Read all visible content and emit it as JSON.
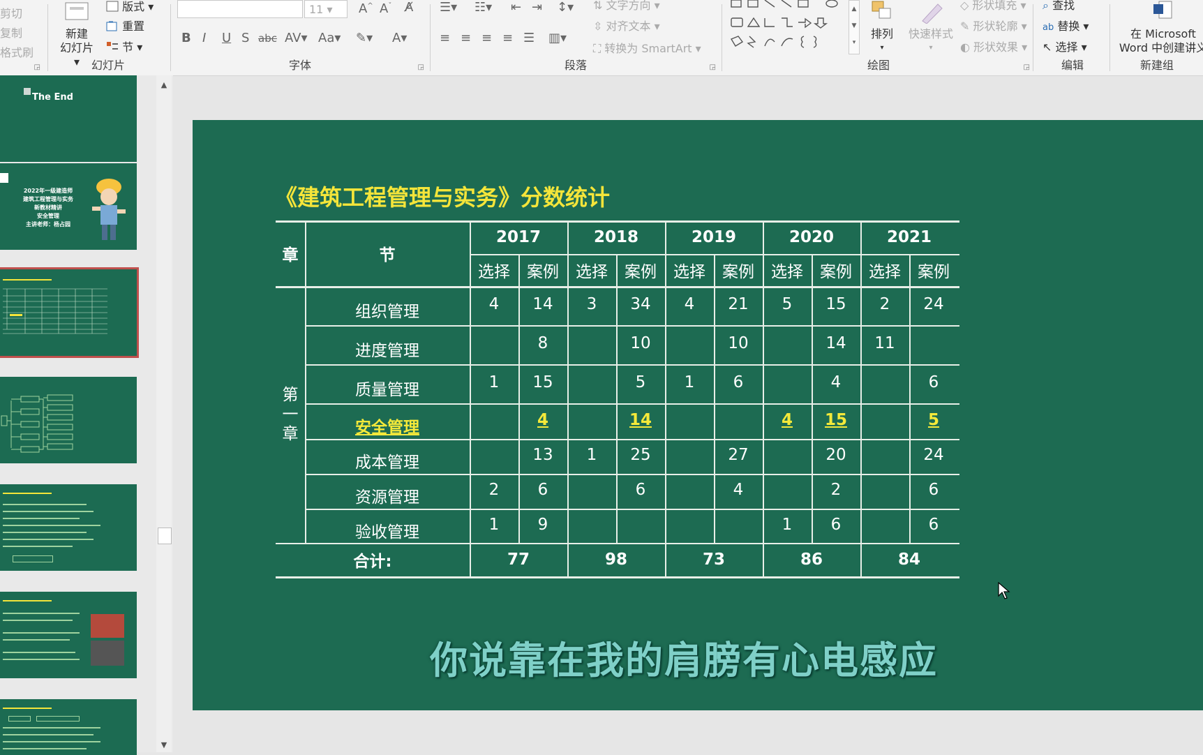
{
  "ribbon": {
    "clipboard": {
      "cut": "剪切",
      "copy": "复制",
      "format_painter": "格式刷"
    },
    "slides": {
      "new_slide_l1": "新建",
      "new_slide_l2": "幻灯片",
      "layout": "版式",
      "reset": "重置",
      "section": "节",
      "label": "幻灯片"
    },
    "font": {
      "size": "11",
      "label": "字体"
    },
    "paragraph": {
      "text_direction": "文字方向",
      "align_text": "对齐文本",
      "convert_smartart": "转换为 SmartArt",
      "label": "段落"
    },
    "drawing": {
      "arrange": "排列",
      "quick_styles": "快速样式",
      "shape_fill": "形状填充",
      "shape_outline": "形状轮廓",
      "shape_effects": "形状效果",
      "label": "绘图"
    },
    "editing": {
      "find": "查找",
      "replace": "替换",
      "select": "选择",
      "label": "编辑"
    },
    "new_group": {
      "line1": "在 Microsoft",
      "line2": "Word 中创建讲义",
      "label": "新建组"
    }
  },
  "thumbnails": [
    {
      "title": "The End"
    },
    {
      "line1": "2022年一级建造师",
      "line2": "建筑工程管理与实务",
      "line3": "新教材精讲",
      "line4": "安全管理",
      "line5": "主讲老师：杨占园"
    }
  ],
  "slide": {
    "title": "《建筑工程管理与实务》分数统计",
    "headers": {
      "chapter": "章",
      "section": "节",
      "years": [
        "2017",
        "2018",
        "2019",
        "2020",
        "2021"
      ],
      "choice": "选择",
      "case": "案例"
    },
    "chapter_chars": [
      "第",
      "一",
      "章"
    ],
    "rows": [
      {
        "name": "组织管理",
        "values": [
          "4",
          "14",
          "3",
          "34",
          "4",
          "21",
          "5",
          "15",
          "2",
          "24"
        ]
      },
      {
        "name": "进度管理",
        "values": [
          "",
          "8",
          "",
          "10",
          "",
          "10",
          "",
          "14",
          "11",
          ""
        ]
      },
      {
        "name": "质量管理",
        "values": [
          "1",
          "15",
          "",
          "5",
          "1",
          "6",
          "",
          "4",
          "",
          "6"
        ]
      },
      {
        "name": "安全管理",
        "values": [
          "",
          "4",
          "",
          "14",
          "",
          "",
          "4",
          "15",
          "",
          "5"
        ],
        "highlight": true
      },
      {
        "name": "成本管理",
        "values": [
          "",
          "13",
          "1",
          "25",
          "",
          "27",
          "",
          "20",
          "",
          "24"
        ]
      },
      {
        "name": "资源管理",
        "values": [
          "2",
          "6",
          "",
          "6",
          "",
          "4",
          "",
          "2",
          "",
          "6"
        ]
      },
      {
        "name": "验收管理",
        "values": [
          "1",
          "9",
          "",
          "",
          "",
          "",
          "1",
          "6",
          "",
          "6"
        ]
      }
    ],
    "total": {
      "label": "合计:",
      "values": [
        "77",
        "98",
        "73",
        "86",
        "84"
      ]
    },
    "subtitle": "你说靠在我的肩膀有心电感应",
    "colors": {
      "bg": "#1d6b52",
      "title": "#f5e53a",
      "highlight": "#f4e93a"
    }
  }
}
